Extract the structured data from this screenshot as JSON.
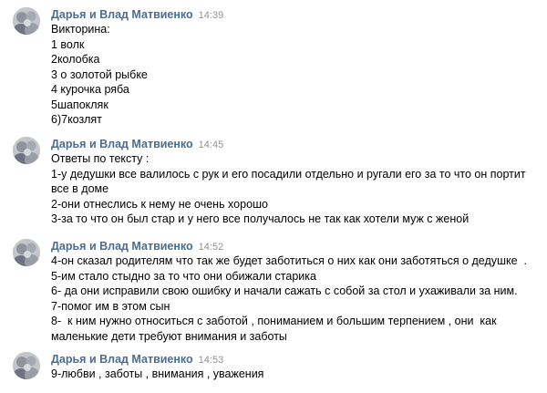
{
  "messages": [
    {
      "author": "Дарья и Влад Матвиенко",
      "time": "14:39",
      "lines": [
        "Викторина:",
        "1 волк",
        "2колобка",
        "3 о золотой рыбке",
        "4 курочка ряба",
        "5шапокляк",
        "6)7козлят"
      ]
    },
    {
      "author": "Дарья и Влад Матвиенко",
      "time": "14:45",
      "lines": [
        "Ответы по тексту :",
        "1-у дедушки все валилось с рук и его посадили отдельно и ругали его за то что он портит все в доме",
        "2-они отнеслись к нему не очень хорошо",
        "3-за то что он был стар и у него все получалось не так как хотели муж с женой"
      ]
    },
    {
      "author": "Дарья и Влад Матвиенко",
      "time": "14:52",
      "lines": [
        "4-он сказал родителям что так же будет заботиться о них как они заботяться о дедушке  .",
        "5-им стало стыдно за то что они обижали старика",
        "6- да они исправили свою ошибку и начали сажать с собой за стол и ухаживали за ним.",
        "7-помог им в этом сын",
        "8-  к ним нужно относиться с заботой , пониманием и большим терпением , они  как маленькие дети требуют внимания и заботы"
      ]
    },
    {
      "author": "Дарья и Влад Матвиенко",
      "time": "14:53",
      "lines": [
        "9-любви , заботы , внимания , уважения"
      ]
    }
  ]
}
